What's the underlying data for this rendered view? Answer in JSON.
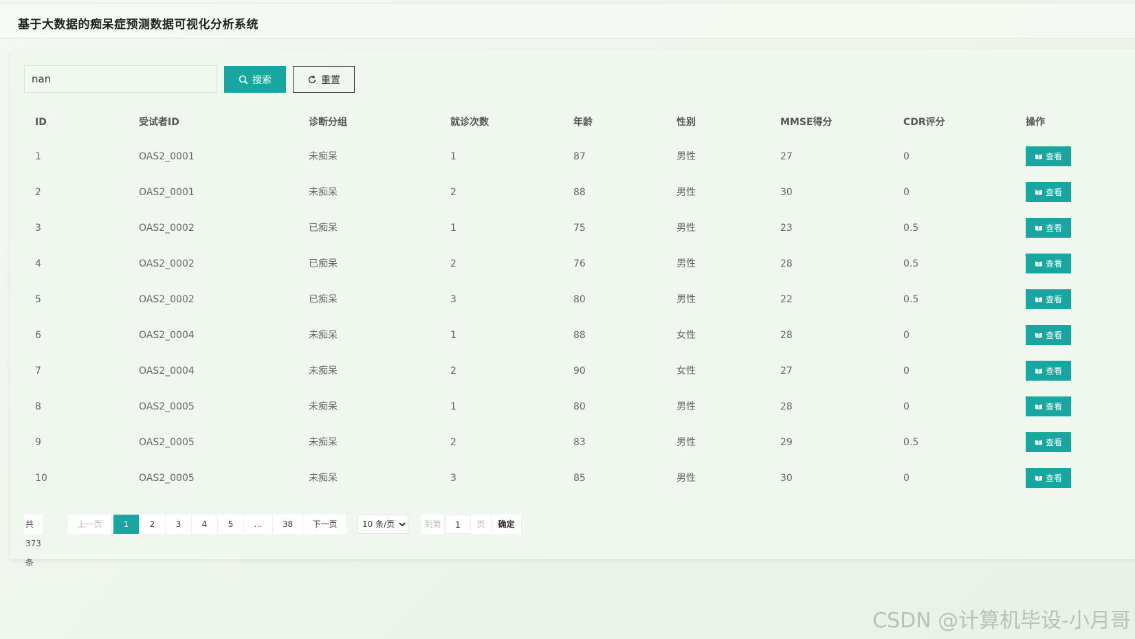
{
  "header": {
    "title": "基于大数据的痴呆症预测数据可视化分析系统"
  },
  "search": {
    "value": "nan",
    "search_label": "搜索",
    "reset_label": "重置"
  },
  "table": {
    "columns": [
      "ID",
      "受试者ID",
      "诊断分组",
      "就诊次数",
      "年龄",
      "性别",
      "MMSE得分",
      "CDR评分",
      "操作"
    ],
    "view_label": "查看",
    "rows": [
      [
        "1",
        "OAS2_0001",
        "未痴呆",
        "1",
        "87",
        "男性",
        "27",
        "0"
      ],
      [
        "2",
        "OAS2_0001",
        "未痴呆",
        "2",
        "88",
        "男性",
        "30",
        "0"
      ],
      [
        "3",
        "OAS2_0002",
        "已痴呆",
        "1",
        "75",
        "男性",
        "23",
        "0.5"
      ],
      [
        "4",
        "OAS2_0002",
        "已痴呆",
        "2",
        "76",
        "男性",
        "28",
        "0.5"
      ],
      [
        "5",
        "OAS2_0002",
        "已痴呆",
        "3",
        "80",
        "男性",
        "22",
        "0.5"
      ],
      [
        "6",
        "OAS2_0004",
        "未痴呆",
        "1",
        "88",
        "女性",
        "28",
        "0"
      ],
      [
        "7",
        "OAS2_0004",
        "未痴呆",
        "2",
        "90",
        "女性",
        "27",
        "0"
      ],
      [
        "8",
        "OAS2_0005",
        "未痴呆",
        "1",
        "80",
        "男性",
        "28",
        "0"
      ],
      [
        "9",
        "OAS2_0005",
        "未痴呆",
        "2",
        "83",
        "男性",
        "29",
        "0.5"
      ],
      [
        "10",
        "OAS2_0005",
        "未痴呆",
        "3",
        "85",
        "男性",
        "30",
        "0"
      ]
    ]
  },
  "pagination": {
    "total": "共 373 条",
    "prev": "上一页",
    "pages": [
      "1",
      "2",
      "3",
      "4",
      "5",
      "…",
      "38"
    ],
    "active_page": "1",
    "next": "下一页",
    "page_size": "10 条/页",
    "goto_prefix": "到第",
    "goto_value": "1",
    "goto_suffix": "页",
    "confirm": "确定"
  },
  "watermark": "CSDN @计算机毕设-小月哥",
  "colors": {
    "accent": "#17a6a0",
    "background": "#eef5ec"
  }
}
